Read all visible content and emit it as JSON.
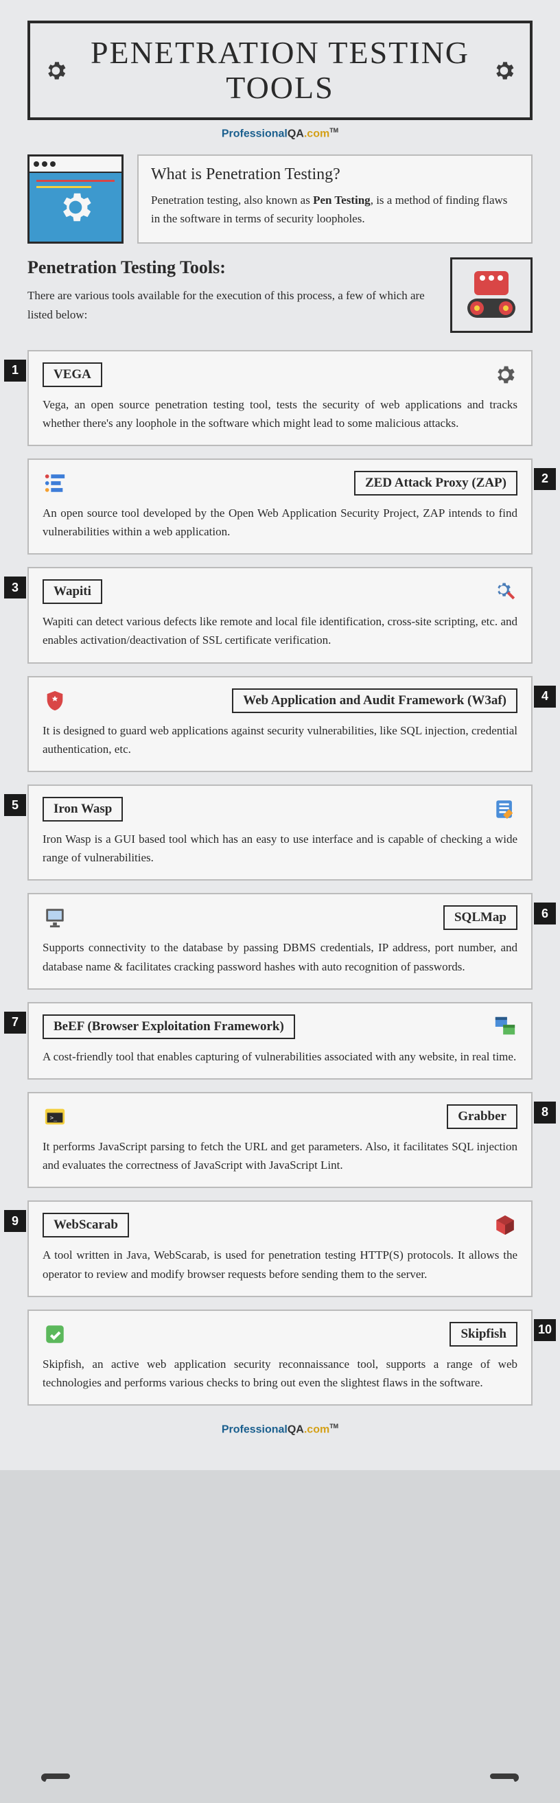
{
  "header": {
    "title": "PENETRATION TESTING TOOLS"
  },
  "brand": {
    "prof": "Professional",
    "qa": "QA",
    "com": ".com",
    "tm": "TM"
  },
  "intro": {
    "heading": "What is Penetration Testing?",
    "body_pre": "Penetration testing, also known as ",
    "body_bold": "Pen Testing",
    "body_post": ", is a method of finding flaws in the software in terms of security loopholes."
  },
  "tools_intro": {
    "heading": "Penetration Testing Tools:",
    "body": "There are various tools available for the execution of this process, a few of which are listed below:"
  },
  "tools": [
    {
      "num": "1",
      "name": "VEGA",
      "side": "left",
      "desc": "Vega, an open source penetration testing tool, tests the security of web applications and tracks whether there's any loophole in the software which might lead to some malicious attacks.",
      "icon": "gear-icon"
    },
    {
      "num": "2",
      "name": "ZED Attack Proxy (ZAP)",
      "side": "right",
      "desc": "An open source tool developed by the Open Web Application Security Project, ZAP intends to find vulnerabilities within a web application.",
      "icon": "list-icon"
    },
    {
      "num": "3",
      "name": "Wapiti",
      "side": "left",
      "desc": "Wapiti can detect various defects like remote and local file identification, cross-site scripting, etc. and enables activation/deactivation of SSL certificate verification.",
      "icon": "gear-wrench-icon"
    },
    {
      "num": "4",
      "name": "Web Application and Audit Framework (W3af)",
      "side": "right",
      "desc": "It is designed to guard web applications against security vulnerabilities, like SQL injection, credential authentication, etc.",
      "icon": "shield-icon"
    },
    {
      "num": "5",
      "name": "Iron Wasp",
      "side": "left",
      "desc": "Iron Wasp is a GUI based tool which has an easy to use interface and is capable of checking a wide range of vulnerabilities.",
      "icon": "note-pencil-icon"
    },
    {
      "num": "6",
      "name": "SQLMap",
      "side": "right",
      "desc": "Supports connectivity to the database by passing DBMS credentials, IP address, port number, and database name & facilitates cracking password hashes with auto recognition of passwords.",
      "icon": "monitor-icon"
    },
    {
      "num": "7",
      "name": "BeEF (Browser Exploitation Framework)",
      "side": "left",
      "desc": "A cost-friendly tool that enables capturing of vulnerabilities associated with any website, in real time.",
      "icon": "windows-icon"
    },
    {
      "num": "8",
      "name": "Grabber",
      "side": "right",
      "desc": "It performs JavaScript parsing to fetch the URL and get parameters. Also, it facilitates SQL injection and evaluates the correctness of JavaScript with JavaScript Lint.",
      "icon": "terminal-icon"
    },
    {
      "num": "9",
      "name": "WebScarab",
      "side": "left",
      "desc": "A tool written in Java, WebScarab, is used for penetration testing HTTP(S) protocols. It allows the operator to review and modify browser requests before sending them to the server.",
      "icon": "box-icon"
    },
    {
      "num": "10",
      "name": "Skipfish",
      "side": "right",
      "desc": "Skipfish, an active web application security reconnaissance tool, supports a range of web technologies and performs various checks to bring out even the slightest flaws in the software.",
      "icon": "check-icon"
    }
  ]
}
